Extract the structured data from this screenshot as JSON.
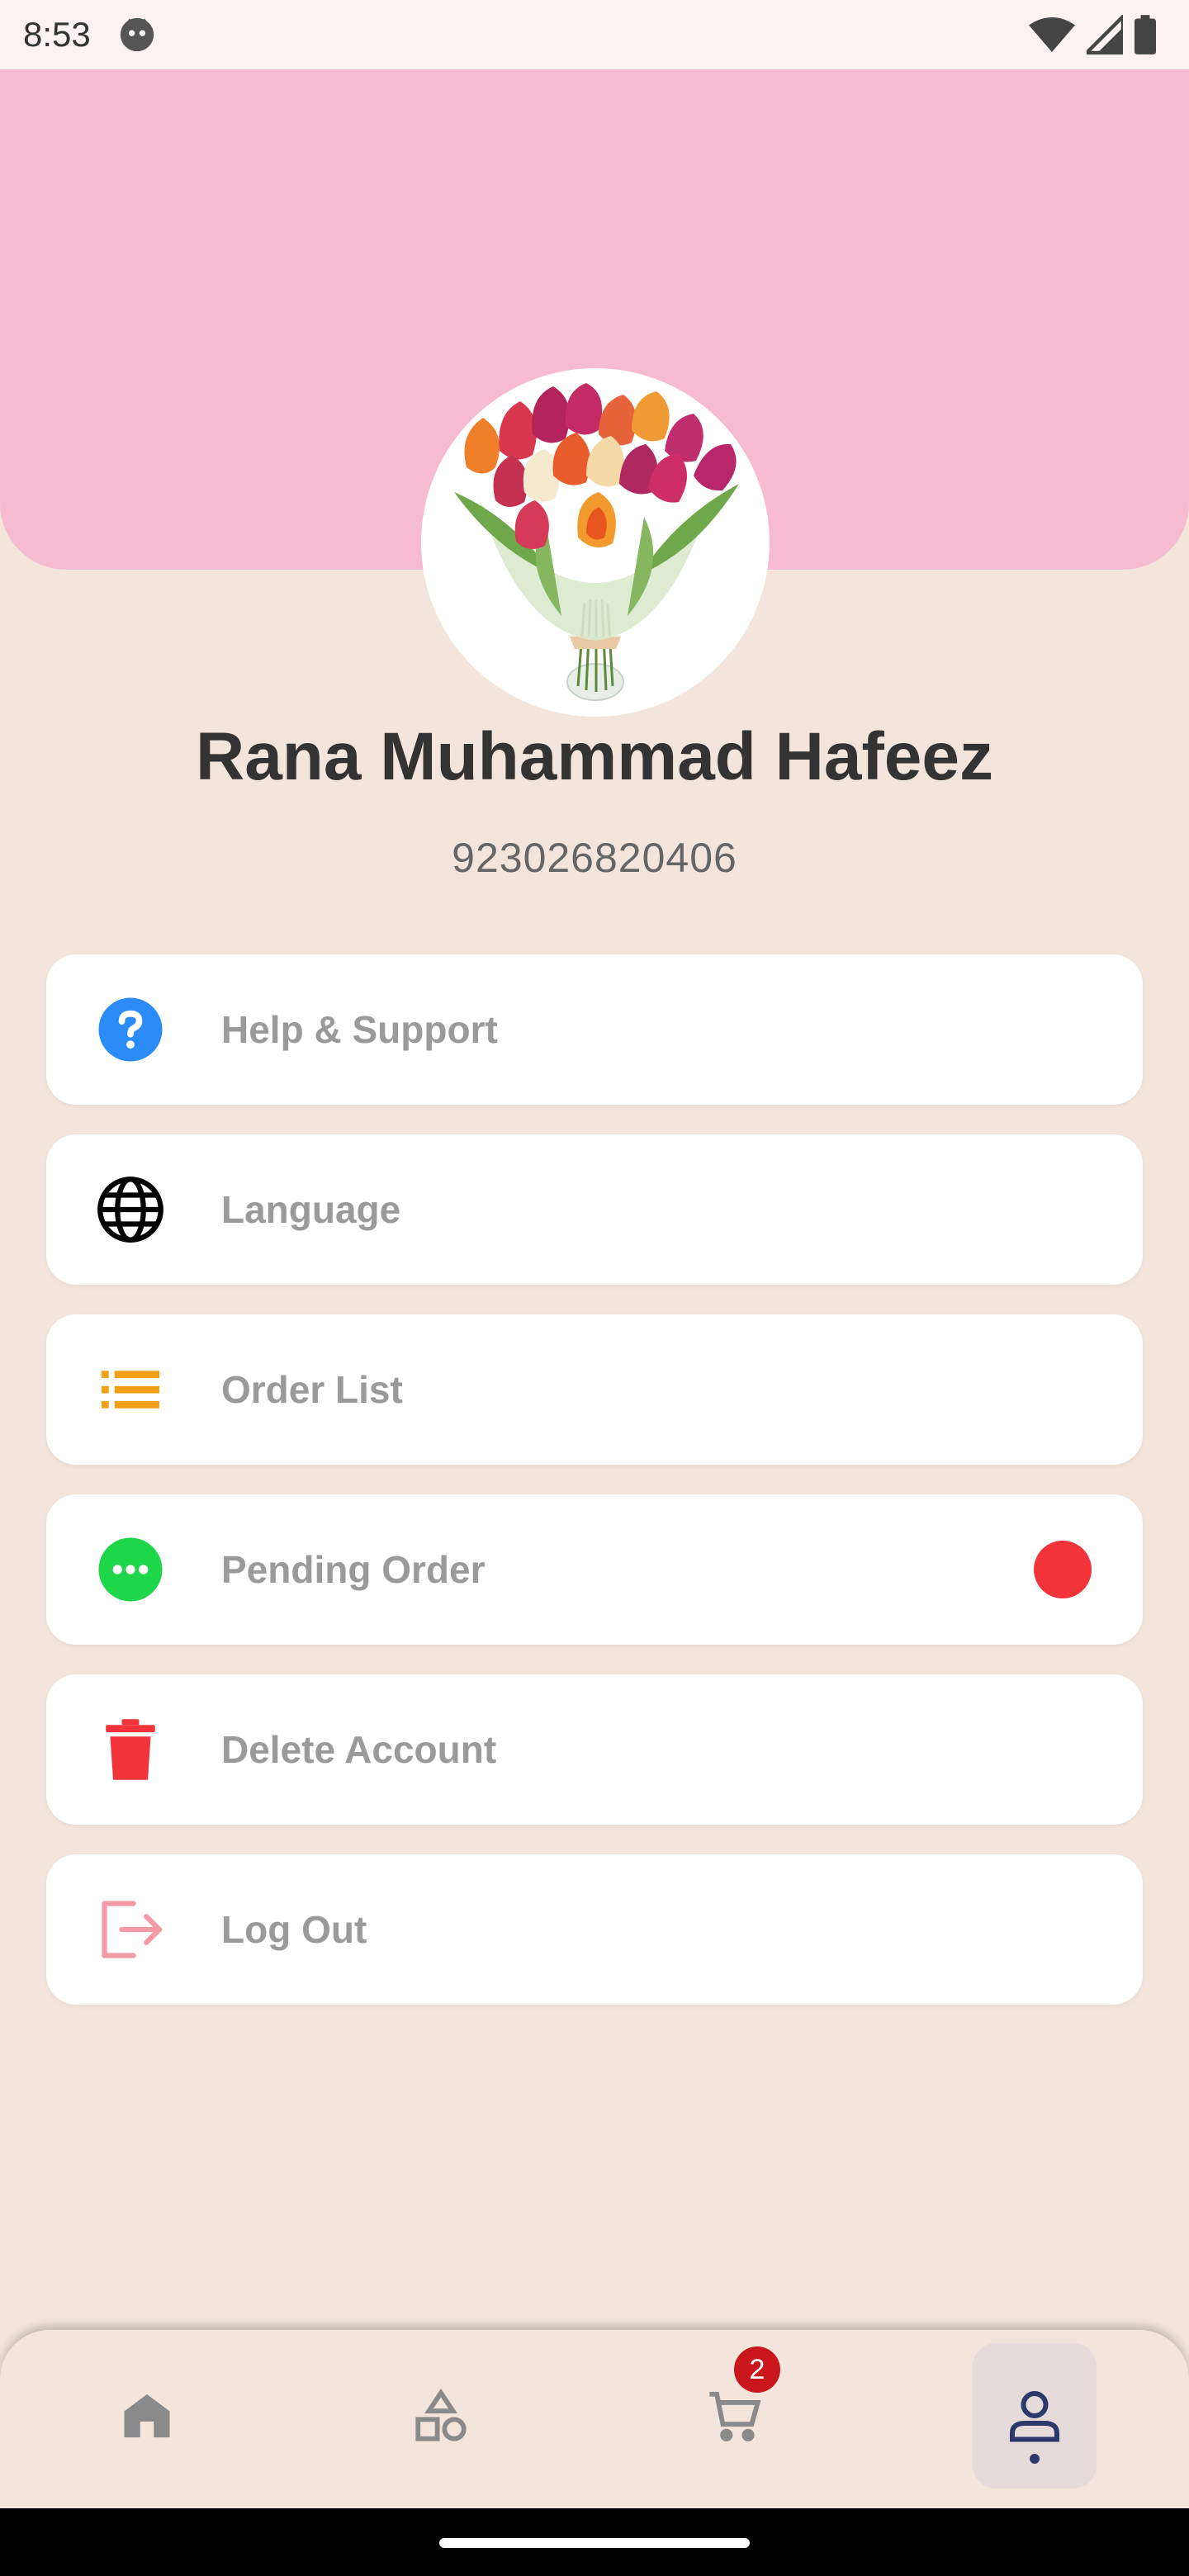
{
  "status_bar": {
    "time": "8:53"
  },
  "profile": {
    "name": "Rana Muhammad Hafeez",
    "phone": "923026820406"
  },
  "menu": [
    {
      "label": "Help & Support",
      "icon": "help-circle-icon",
      "color": "#2b8cf7"
    },
    {
      "label": "Language",
      "icon": "globe-icon",
      "color": "#000000"
    },
    {
      "label": "Order List",
      "icon": "list-icon",
      "color": "#f3a019"
    },
    {
      "label": "Pending Order",
      "icon": "more-horizontal-circle-icon",
      "color": "#1ed64a",
      "indicator_color": "#f2343a"
    },
    {
      "label": "Delete Account",
      "icon": "trash-icon",
      "color": "#f2343a"
    },
    {
      "label": "Log Out",
      "icon": "logout-icon",
      "color": "#f39aa6"
    }
  ],
  "bottom_nav": {
    "items": [
      "home-icon",
      "categories-icon",
      "cart-icon",
      "profile-icon"
    ],
    "active": "profile-icon",
    "cart_badge": "2"
  },
  "colors": {
    "header": "#f7bbd1",
    "background": "#f3e5db",
    "label": "#9a9a9a"
  }
}
